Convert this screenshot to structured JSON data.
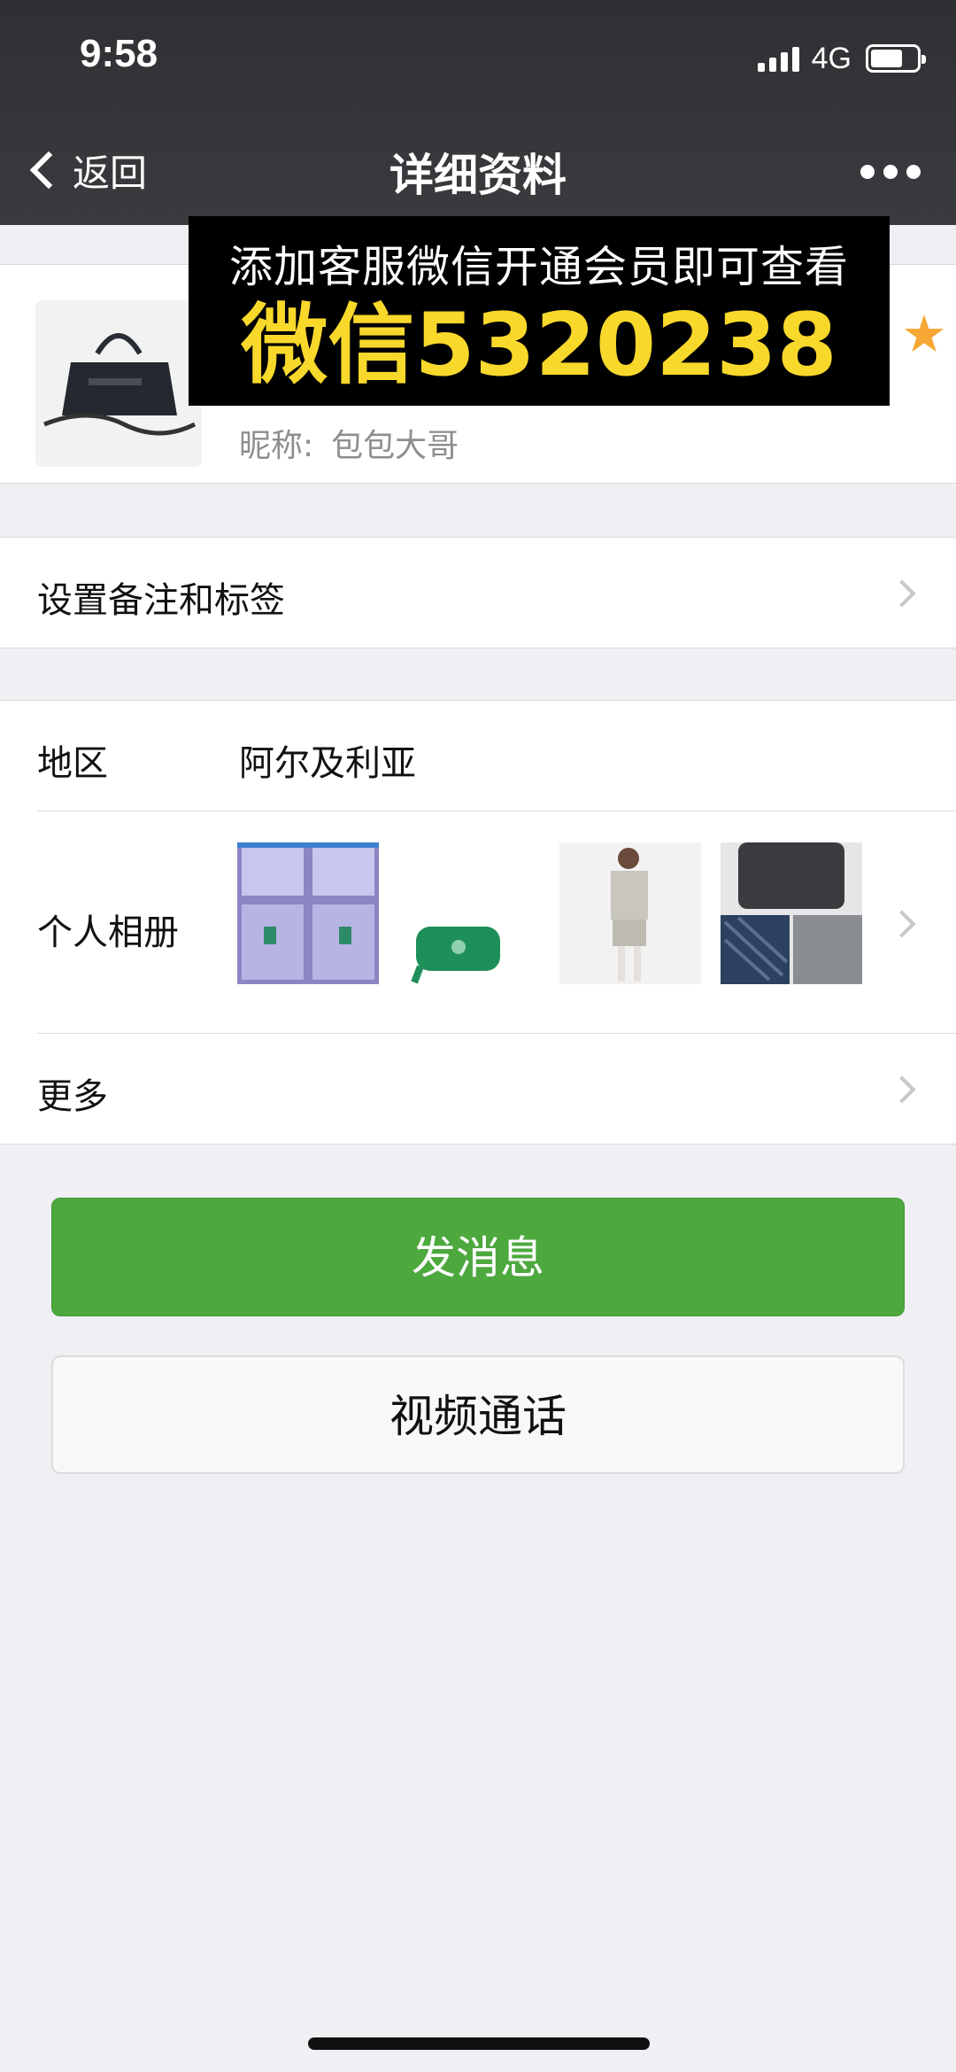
{
  "status_bar": {
    "time": "9:58",
    "network": "4G",
    "battery_level": 0.7,
    "signal_bars": 4
  },
  "nav": {
    "back_label": "返回",
    "title": "详细资料",
    "more_icon": "more-dots-icon"
  },
  "ad": {
    "line1": "添加客服微信开通会员即可查看",
    "line2": "微信5320238",
    "line2_color": "#f8d82b"
  },
  "profile": {
    "nickname_label": "昵称:",
    "nickname_value": "包包大哥",
    "star_color": "#f7a733"
  },
  "rows": {
    "remark_label": "设置备注和标签",
    "region_label": "地区",
    "region_value": "阿尔及利亚",
    "album_label": "个人相册",
    "more_label": "更多"
  },
  "buttons": {
    "send": "发消息",
    "video": "视频通话",
    "send_color": "#4da83e"
  },
  "album_photos": [
    "boxes-photo",
    "green-bag-photo",
    "model-photo",
    "balenciaga-bags-photo"
  ]
}
